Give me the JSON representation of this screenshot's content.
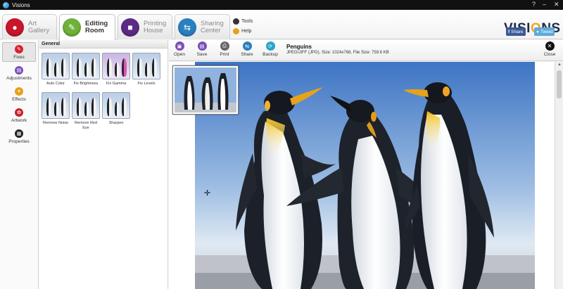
{
  "window": {
    "title": "Visions",
    "controls": [
      "?",
      "–",
      "✕"
    ]
  },
  "tabs": [
    {
      "line1": "Art",
      "line2": "Gallery",
      "color": "#c8162a",
      "glyph": "●"
    },
    {
      "line1": "Editing",
      "line2": "Room",
      "color": "#6fb13a",
      "glyph": "✎"
    },
    {
      "line1": "Printing",
      "line2": "House",
      "color": "#5b2a86",
      "glyph": "■"
    },
    {
      "line1": "Sharing",
      "line2": "Center",
      "color": "#2a7fc1",
      "glyph": "⇆"
    }
  ],
  "links": {
    "tools": "Tools",
    "help": "Help"
  },
  "brand": {
    "logo_a": "VISI",
    "logo_o": "O",
    "logo_b": "NS",
    "share": "Share",
    "tweet": "Tweet"
  },
  "sidebar": [
    {
      "label": "Fixes",
      "color": "#d8222f",
      "glyph": "✎"
    },
    {
      "label": "Adjustments",
      "color": "#7a4fb5",
      "glyph": "▤"
    },
    {
      "label": "Effects",
      "color": "#e6a119",
      "glyph": "✦"
    },
    {
      "label": "Artwork",
      "color": "#c9212b",
      "glyph": "✿"
    },
    {
      "label": "Properties",
      "color": "#222222",
      "glyph": "▦"
    }
  ],
  "panel": {
    "group": "General",
    "effects": [
      {
        "label": "Auto Color"
      },
      {
        "label": "Fix Brightness"
      },
      {
        "label": "Fix Gamma"
      },
      {
        "label": "Fix Levels"
      },
      {
        "label": "Remove Noise"
      },
      {
        "label": "Remove Red Eye"
      },
      {
        "label": "Sharpen"
      }
    ]
  },
  "toolbar": [
    {
      "label": "Open",
      "color": "#7a4fb5",
      "glyph": "▣"
    },
    {
      "label": "Save",
      "color": "#7a4fb5",
      "glyph": "▤"
    },
    {
      "label": "Print",
      "color": "#666666",
      "glyph": "⎙"
    },
    {
      "label": "Share",
      "color": "#2a7fc1",
      "glyph": "⇆"
    },
    {
      "label": "Backup",
      "color": "#2aa5c9",
      "glyph": "⟳"
    }
  ],
  "file": {
    "name": "Penguins",
    "meta": "JPEG/JIFF (JPG), Size: 1024x768, File Size: 759.6 KB",
    "close": "Close"
  }
}
